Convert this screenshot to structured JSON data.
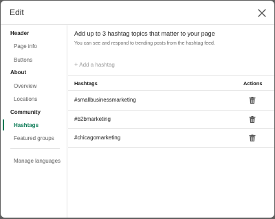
{
  "dialog": {
    "title": "Edit"
  },
  "sidebar": {
    "sections": [
      {
        "label": "Header",
        "items": [
          "Page info",
          "Buttons"
        ]
      },
      {
        "label": "About",
        "items": [
          "Overview",
          "Locations"
        ]
      },
      {
        "label": "Community",
        "items": [
          "Hashtags",
          "Featured groups"
        ]
      }
    ],
    "active_item": "Hashtags",
    "manage_languages": "Manage languages"
  },
  "main": {
    "heading": "Add up to 3 hashtag topics that matter to your page",
    "subtext": "You can see and respond to trending posts from the hashtag feed.",
    "add_label": "Add a hashtag",
    "table": {
      "col_hashtags": "Hashtags",
      "col_actions": "Actions",
      "rows": [
        "#smallbusinessmarketing",
        "#b2bmarketing",
        "#chicagomarketing"
      ]
    }
  },
  "colors": {
    "accent": "#0a7a55",
    "border": "#e2e2e2",
    "backdrop": "#5f5f5f"
  },
  "icons": {
    "close": "close-icon",
    "delete": "trash-icon",
    "add": "plus-icon"
  }
}
